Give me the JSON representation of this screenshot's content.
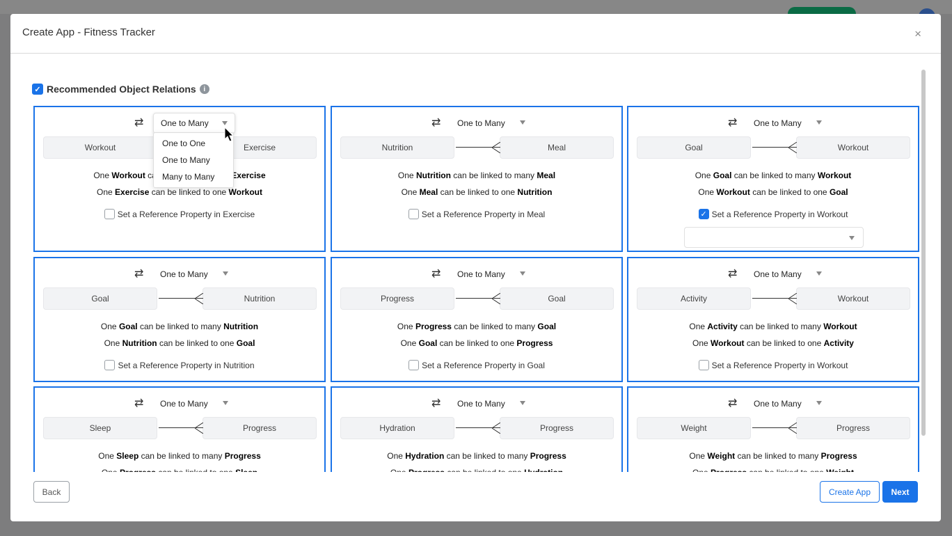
{
  "modal": {
    "title": "Create App - Fitness Tracker",
    "close_label": "×"
  },
  "section": {
    "title": "Recommended Object Relations",
    "checked": true
  },
  "reference_label_prefix": "Set a Reference Property in",
  "relation_options": [
    "One to One",
    "One to Many",
    "Many to Many"
  ],
  "relations": [
    {
      "from": "Workout",
      "to": "Exercise",
      "type": "One to Many",
      "line1": [
        "One",
        "Workout",
        "can be linked to many",
        "Exercise"
      ],
      "line2": [
        "One",
        "Exercise",
        "can be linked to one",
        "Workout"
      ],
      "ref_checked": false,
      "dropdown_open": true
    },
    {
      "from": "Nutrition",
      "to": "Meal",
      "type": "One to Many",
      "line1": [
        "One",
        "Nutrition",
        "can be linked to many",
        "Meal"
      ],
      "line2": [
        "One",
        "Meal",
        "can be linked to one",
        "Nutrition"
      ],
      "ref_checked": false
    },
    {
      "from": "Goal",
      "to": "Workout",
      "type": "One to Many",
      "line1": [
        "One",
        "Goal",
        "can be linked to many",
        "Workout"
      ],
      "line2": [
        "One",
        "Workout",
        "can be linked to one",
        "Goal"
      ],
      "ref_checked": true
    },
    {
      "from": "Goal",
      "to": "Nutrition",
      "type": "One to Many",
      "line1": [
        "One",
        "Goal",
        "can be linked to many",
        "Nutrition"
      ],
      "line2": [
        "One",
        "Nutrition",
        "can be linked to one",
        "Goal"
      ],
      "ref_checked": false
    },
    {
      "from": "Progress",
      "to": "Goal",
      "type": "One to Many",
      "line1": [
        "One",
        "Progress",
        "can be linked to many",
        "Goal"
      ],
      "line2": [
        "One",
        "Goal",
        "can be linked to one",
        "Progress"
      ],
      "ref_checked": false
    },
    {
      "from": "Activity",
      "to": "Workout",
      "type": "One to Many",
      "line1": [
        "One",
        "Activity",
        "can be linked to many",
        "Workout"
      ],
      "line2": [
        "One",
        "Workout",
        "can be linked to one",
        "Activity"
      ],
      "ref_checked": false
    },
    {
      "from": "Sleep",
      "to": "Progress",
      "type": "One to Many",
      "line1": [
        "One",
        "Sleep",
        "can be linked to many",
        "Progress"
      ],
      "line2": [
        "One",
        "Progress",
        "can be linked to one",
        "Sleep"
      ],
      "ref_checked": false
    },
    {
      "from": "Hydration",
      "to": "Progress",
      "type": "One to Many",
      "line1": [
        "One",
        "Hydration",
        "can be linked to many",
        "Progress"
      ],
      "line2": [
        "One",
        "Progress",
        "can be linked to one",
        "Hydration"
      ],
      "ref_checked": false
    },
    {
      "from": "Weight",
      "to": "Progress",
      "type": "One to Many",
      "line1": [
        "One",
        "Weight",
        "can be linked to many",
        "Progress"
      ],
      "line2": [
        "One",
        "Progress",
        "can be linked to one",
        "Weight"
      ],
      "ref_checked": false
    }
  ],
  "footer": {
    "back": "Back",
    "create_app": "Create App",
    "next": "Next"
  },
  "colors": {
    "accent": "#1a73e8"
  }
}
